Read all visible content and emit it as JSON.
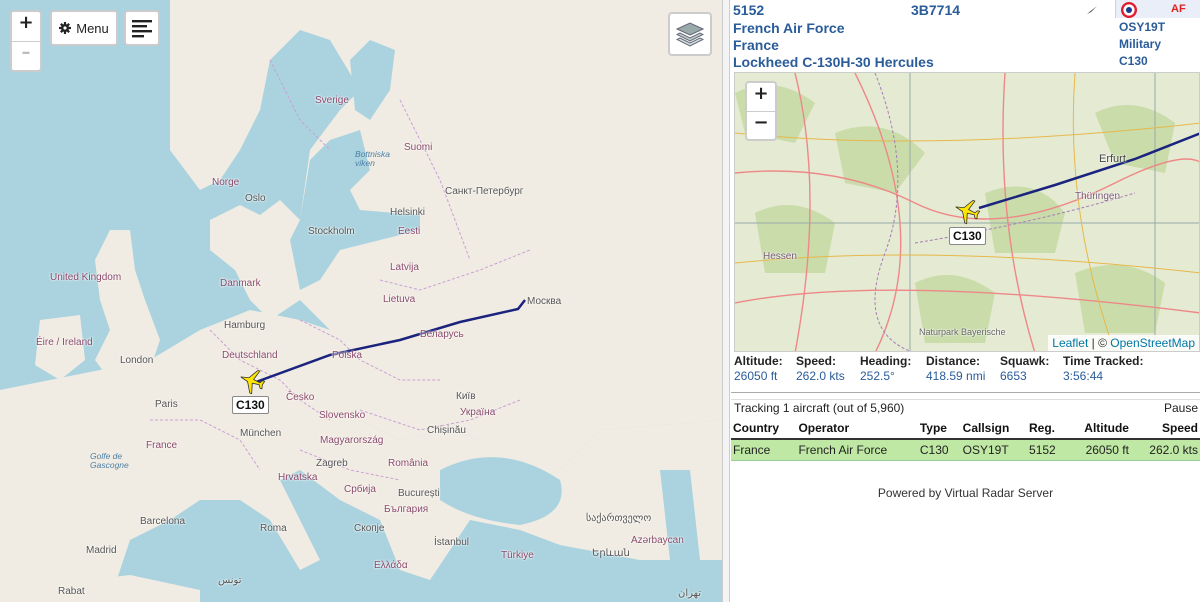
{
  "main_map": {
    "controls": {
      "zoom_in": "+",
      "zoom_out": "–",
      "menu_label": "Menu"
    },
    "aircraft_label": "C130",
    "places": {
      "sverige": "Sverige",
      "suomi": "Suomi",
      "norge": "Norge",
      "oslo": "Oslo",
      "helsinki": "Helsinki",
      "stockholm": "Stockholm",
      "eesti": "Eesti",
      "spb": "Санкт-Петербург",
      "latvija": "Latvija",
      "lietuva": "Lietuva",
      "moskva": "Москва",
      "danmark": "Danmark",
      "uk": "United Kingdom",
      "ireland": "Éire / Ireland",
      "london": "London",
      "hamburg": "Hamburg",
      "deutschland": "Deutschland",
      "polska": "Polska",
      "belarus": "Беларусь",
      "paris": "Paris",
      "cesko": "Česko",
      "kyiv": "Київ",
      "ukraina": "Україна",
      "slovensko": "Slovensko",
      "france": "France",
      "munchen": "München",
      "magyarorszag": "Magyarország",
      "chisinau": "Chișinău",
      "zagreb": "Zagreb",
      "romania": "România",
      "hrvatska": "Hrvatska",
      "srbija": "Србија",
      "bucuresti": "București",
      "balgariya": "България",
      "barcelona": "Barcelona",
      "roma": "Roma",
      "skopje": "Скопје",
      "sakartvelo": "საქართველო",
      "madrid": "Madrid",
      "istanbul": "İstanbul",
      "turkiye": "Türkiye",
      "yerevan": "Երևան",
      "azerbaycan": "Azərbaycan",
      "ellada": "Ελλάδα",
      "rabat": "Rabat",
      "tunis": "تونس",
      "tehran": "تهران",
      "mexico_seas": "Golfe de Gascogne",
      "botnia": "Bottniska viken"
    }
  },
  "detail": {
    "registration": "5152",
    "icao": "3B7714",
    "operator": "French Air Force",
    "country": "France",
    "model": "Lockheed C-130H-30 Hercules",
    "callsign": "OSY19T",
    "category": "Military",
    "type": "C130",
    "flag_text": "AF",
    "mini_map": {
      "zoom_in": "+",
      "zoom_out": "−",
      "aircraft_label": "C130",
      "places": {
        "erfurt": "Erfurt",
        "thuringen": "Thüringen",
        "hessen": "Hessen",
        "bayerische": "Naturpark Bayerische"
      },
      "attribution_leaflet": "Leaflet",
      "attribution_sep": " | © ",
      "attribution_osm": "OpenStreetMap"
    },
    "stats": [
      {
        "label": "Altitude:",
        "value": "26050 ft"
      },
      {
        "label": "Speed:",
        "value": "262.0 kts"
      },
      {
        "label": "Heading:",
        "value": "252.5°"
      },
      {
        "label": "Distance:",
        "value": "418.59 nmi"
      },
      {
        "label": "Squawk:",
        "value": "6653"
      },
      {
        "label": "Time Tracked:",
        "value": "3:56:44"
      }
    ]
  },
  "list": {
    "tracking_text": "Tracking 1 aircraft (out of 5,960)",
    "pause_label": "Pause",
    "headers": [
      "Country",
      "Operator",
      "Type",
      "Callsign",
      "Reg.",
      "Altitude",
      "Speed"
    ],
    "rows": [
      [
        "France",
        "French Air Force",
        "C130",
        "OSY19T",
        "5152",
        "26050 ft",
        "262.0 kts"
      ]
    ]
  },
  "footer": {
    "powered_by": "Powered by Virtual Radar Server"
  },
  "colors": {
    "track": "#1a237e",
    "accent": "#2a5c9a",
    "selected_row": "#bfe8a4",
    "water": "#aad3df",
    "land": "#eae6de"
  }
}
